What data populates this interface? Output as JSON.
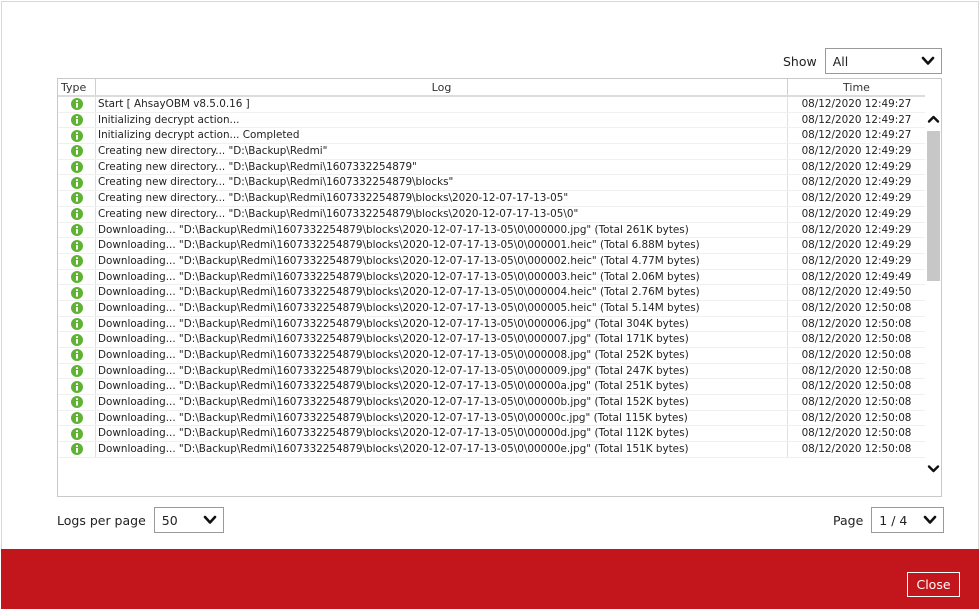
{
  "header": {
    "show_label": "Show",
    "show_value": "All"
  },
  "table": {
    "columns": {
      "type": "Type",
      "log": "Log",
      "time": "Time"
    },
    "rows": [
      {
        "log": "Start [ AhsayOBM v8.5.0.16 ]",
        "time": "08/12/2020 12:49:27"
      },
      {
        "log": "Initializing decrypt action...",
        "time": "08/12/2020 12:49:27"
      },
      {
        "log": "Initializing decrypt action... Completed",
        "time": "08/12/2020 12:49:27"
      },
      {
        "log": "Creating new directory... \"D:\\Backup\\Redmi\"",
        "time": "08/12/2020 12:49:29"
      },
      {
        "log": "Creating new directory... \"D:\\Backup\\Redmi\\1607332254879\"",
        "time": "08/12/2020 12:49:29"
      },
      {
        "log": "Creating new directory... \"D:\\Backup\\Redmi\\1607332254879\\blocks\"",
        "time": "08/12/2020 12:49:29"
      },
      {
        "log": "Creating new directory... \"D:\\Backup\\Redmi\\1607332254879\\blocks\\2020-12-07-17-13-05\"",
        "time": "08/12/2020 12:49:29"
      },
      {
        "log": "Creating new directory... \"D:\\Backup\\Redmi\\1607332254879\\blocks\\2020-12-07-17-13-05\\0\"",
        "time": "08/12/2020 12:49:29"
      },
      {
        "log": "Downloading... \"D:\\Backup\\Redmi\\1607332254879\\blocks\\2020-12-07-17-13-05\\0\\000000.jpg\" (Total 261K bytes)",
        "time": "08/12/2020 12:49:29"
      },
      {
        "log": "Downloading... \"D:\\Backup\\Redmi\\1607332254879\\blocks\\2020-12-07-17-13-05\\0\\000001.heic\" (Total 6.88M bytes)",
        "time": "08/12/2020 12:49:29"
      },
      {
        "log": "Downloading... \"D:\\Backup\\Redmi\\1607332254879\\blocks\\2020-12-07-17-13-05\\0\\000002.heic\" (Total 4.77M bytes)",
        "time": "08/12/2020 12:49:29"
      },
      {
        "log": "Downloading... \"D:\\Backup\\Redmi\\1607332254879\\blocks\\2020-12-07-17-13-05\\0\\000003.heic\" (Total 2.06M bytes)",
        "time": "08/12/2020 12:49:49"
      },
      {
        "log": "Downloading... \"D:\\Backup\\Redmi\\1607332254879\\blocks\\2020-12-07-17-13-05\\0\\000004.heic\" (Total 2.76M bytes)",
        "time": "08/12/2020 12:49:50"
      },
      {
        "log": "Downloading... \"D:\\Backup\\Redmi\\1607332254879\\blocks\\2020-12-07-17-13-05\\0\\000005.heic\" (Total 5.14M bytes)",
        "time": "08/12/2020 12:50:08"
      },
      {
        "log": "Downloading... \"D:\\Backup\\Redmi\\1607332254879\\blocks\\2020-12-07-17-13-05\\0\\000006.jpg\" (Total 304K bytes)",
        "time": "08/12/2020 12:50:08"
      },
      {
        "log": "Downloading... \"D:\\Backup\\Redmi\\1607332254879\\blocks\\2020-12-07-17-13-05\\0\\000007.jpg\" (Total 171K bytes)",
        "time": "08/12/2020 12:50:08"
      },
      {
        "log": "Downloading... \"D:\\Backup\\Redmi\\1607332254879\\blocks\\2020-12-07-17-13-05\\0\\000008.jpg\" (Total 252K bytes)",
        "time": "08/12/2020 12:50:08"
      },
      {
        "log": "Downloading... \"D:\\Backup\\Redmi\\1607332254879\\blocks\\2020-12-07-17-13-05\\0\\000009.jpg\" (Total 247K bytes)",
        "time": "08/12/2020 12:50:08"
      },
      {
        "log": "Downloading... \"D:\\Backup\\Redmi\\1607332254879\\blocks\\2020-12-07-17-13-05\\0\\00000a.jpg\" (Total 251K bytes)",
        "time": "08/12/2020 12:50:08"
      },
      {
        "log": "Downloading... \"D:\\Backup\\Redmi\\1607332254879\\blocks\\2020-12-07-17-13-05\\0\\00000b.jpg\" (Total 152K bytes)",
        "time": "08/12/2020 12:50:08"
      },
      {
        "log": "Downloading... \"D:\\Backup\\Redmi\\1607332254879\\blocks\\2020-12-07-17-13-05\\0\\00000c.jpg\" (Total 115K bytes)",
        "time": "08/12/2020 12:50:08"
      },
      {
        "log": "Downloading... \"D:\\Backup\\Redmi\\1607332254879\\blocks\\2020-12-07-17-13-05\\0\\00000d.jpg\" (Total 112K bytes)",
        "time": "08/12/2020 12:50:08"
      },
      {
        "log": "Downloading... \"D:\\Backup\\Redmi\\1607332254879\\blocks\\2020-12-07-17-13-05\\0\\00000e.jpg\" (Total 151K bytes)",
        "time": "08/12/2020 12:50:08"
      }
    ],
    "row_icon": "info-icon",
    "icon_color": "#5fb233"
  },
  "footer": {
    "logs_per_page_label": "Logs per page",
    "logs_per_page_value": "50",
    "page_label": "Page",
    "page_value": "1 / 4"
  },
  "actions": {
    "close_label": "Close"
  },
  "colors": {
    "bottom_bar": "#c3161c",
    "info_green": "#5fb233"
  }
}
